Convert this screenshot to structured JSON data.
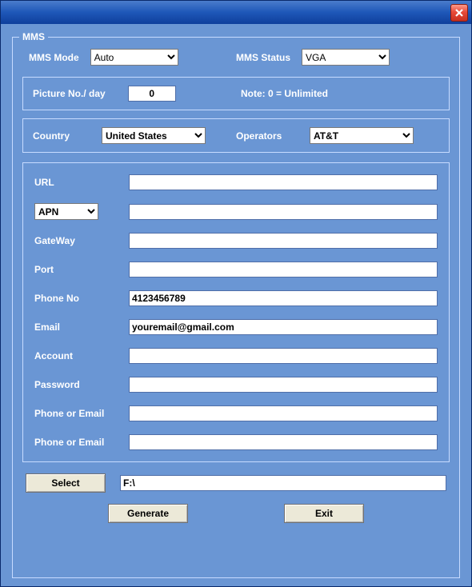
{
  "titlebar": {
    "close_title": "Close"
  },
  "group": {
    "title": "MMS"
  },
  "modeRow": {
    "mode_label": "MMS Mode",
    "mode_value": "Auto",
    "status_label": "MMS Status",
    "status_value": "VGA"
  },
  "picRow": {
    "label": "Picture No./ day",
    "value": "0",
    "note": "Note: 0 = Unlimited"
  },
  "geoRow": {
    "country_label": "Country",
    "country_value": "United States",
    "operators_label": "Operators",
    "operators_value": "AT&T"
  },
  "fields": {
    "url_label": "URL",
    "url_value": "",
    "apn_label": "APN",
    "apn_value": "",
    "gateway_label": "GateWay",
    "gateway_value": "",
    "port_label": "Port",
    "port_value": "",
    "phone_label": "Phone No",
    "phone_value": "4123456789",
    "email_label": "Email",
    "email_value": "youremail@gmail.com",
    "account_label": "Account",
    "account_value": "",
    "password_label": "Password",
    "password_value": "",
    "pe1_label": "Phone or Email",
    "pe1_value": "",
    "pe2_label": "Phone or Email",
    "pe2_value": ""
  },
  "bottom": {
    "select_label": "Select",
    "path_value": "F:\\"
  },
  "buttons": {
    "generate": "Generate",
    "exit": "Exit"
  }
}
